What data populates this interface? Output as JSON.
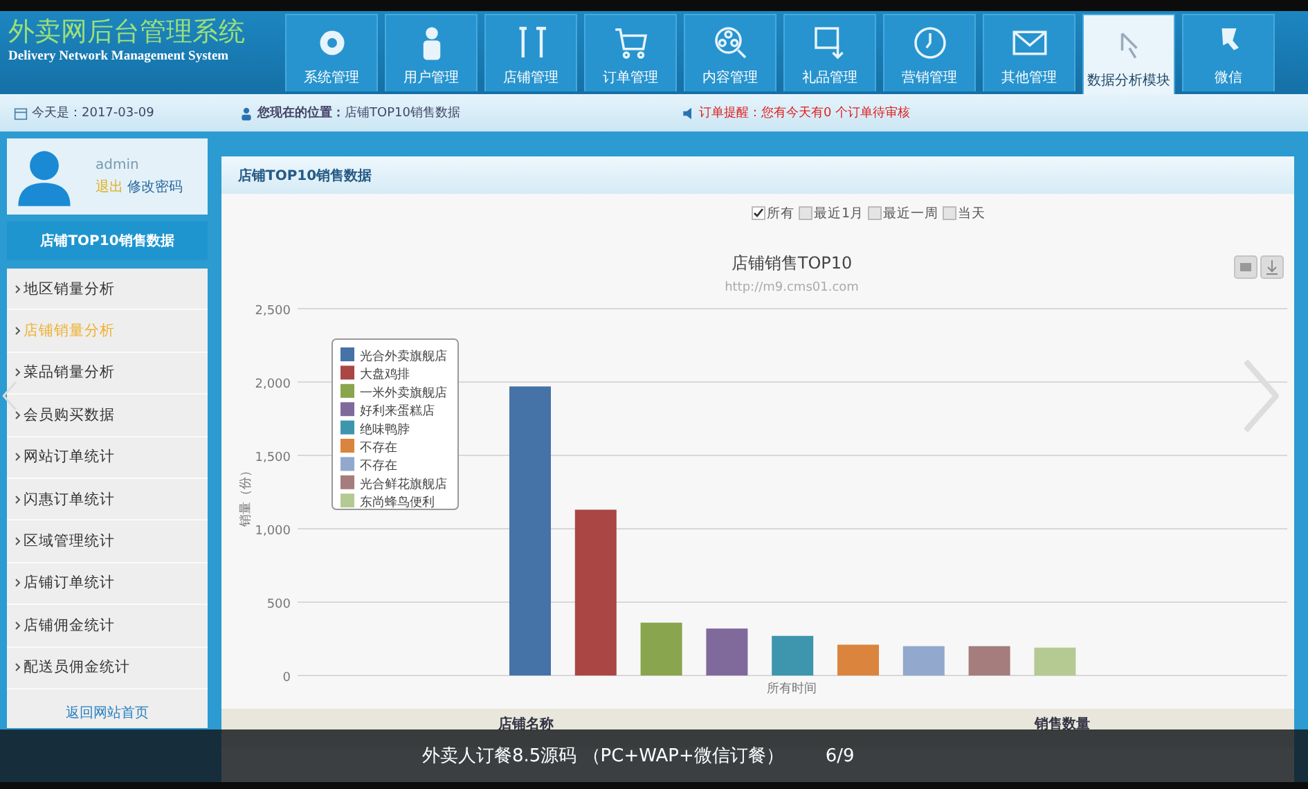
{
  "header": {
    "title": "外卖网后台管理系统",
    "subtitle": "Delivery Network Management System",
    "nav": [
      {
        "label": "系统管理",
        "selected": false
      },
      {
        "label": "用户管理",
        "selected": false
      },
      {
        "label": "店铺管理",
        "selected": false
      },
      {
        "label": "订单管理",
        "selected": false
      },
      {
        "label": "内容管理",
        "selected": false
      },
      {
        "label": "礼品管理",
        "selected": false
      },
      {
        "label": "营销管理",
        "selected": false
      },
      {
        "label": "其他管理",
        "selected": false
      },
      {
        "label": "数据分析模块",
        "selected": true
      },
      {
        "label": "微信",
        "selected": false
      }
    ]
  },
  "info_bar": {
    "date": "今天是：2017-03-09",
    "location": "**您现在的位置：**店铺TOP10销售数据",
    "alert": "订单提醒：您有今天有0 个订单待审核"
  },
  "sidebar": {
    "user": "admin",
    "logout": "退出",
    "change_password": "修改密码",
    "title": "店铺TOP10销售数据",
    "items": [
      {
        "label": "地区销量分析",
        "selected": false
      },
      {
        "label": "店铺销量分析",
        "selected": true
      },
      {
        "label": "菜品销量分析",
        "selected": false
      },
      {
        "label": "会员购买数据",
        "selected": false
      },
      {
        "label": "网站订单统计",
        "selected": false
      },
      {
        "label": "闪惠订单统计",
        "selected": false
      },
      {
        "label": "区域管理统计",
        "selected": false
      },
      {
        "label": "店铺订单统计",
        "selected": false
      },
      {
        "label": "店铺佣金统计",
        "selected": false
      },
      {
        "label": "配送员佣金统计",
        "selected": false
      }
    ],
    "back_link": "返回网站首页"
  },
  "panel": {
    "title": "店铺TOP10销售数据",
    "filters": [
      {
        "label": "所有",
        "checked": true
      },
      {
        "label": "最近1月",
        "checked": false
      },
      {
        "label": "最近一周",
        "checked": false
      },
      {
        "label": "当天",
        "checked": false
      }
    ],
    "chart_subtitle": "http://m9.cms01.com",
    "chart_data": {
      "type": "bar",
      "grid": true,
      "legend": true,
      "title": "店铺销售TOP10",
      "ylabel": "销量（份）",
      "categories": [
        "所有时间"
      ],
      "ylim": [
        0,
        2500
      ],
      "yticks": [
        {
          "value": 0,
          "label": "0"
        },
        {
          "value": 500,
          "label": "500"
        },
        {
          "value": 1000,
          "label": "1,000"
        },
        {
          "value": 1500,
          "label": "1,500"
        },
        {
          "value": 2000,
          "label": "2,000"
        },
        {
          "value": 2500,
          "label": "2,500"
        }
      ],
      "series": [
        {
          "name": "光合外卖旗舰店",
          "color": "#4572a7",
          "values": [
            1970
          ]
        },
        {
          "name": "大盘鸡排",
          "color": "#aa4643",
          "values": [
            1130
          ]
        },
        {
          "name": "一米外卖旗舰店",
          "color": "#89a54e",
          "values": [
            360
          ]
        },
        {
          "name": "好利来蛋糕店",
          "color": "#80699b",
          "values": [
            320
          ]
        },
        {
          "name": "绝味鸭脖",
          "color": "#3d96ae",
          "values": [
            270
          ]
        },
        {
          "name": "不存在",
          "color": "#db843d",
          "values": [
            210
          ]
        },
        {
          "name": "不存在",
          "color": "#92a8cd",
          "values": [
            200
          ]
        },
        {
          "name": "光合鲜花旗舰店",
          "color": "#a47d7c",
          "values": [
            200
          ]
        },
        {
          "name": "东尚蜂鸟便利",
          "color": "#b5ca92",
          "values": [
            190
          ]
        }
      ]
    },
    "table_columns": [
      "店铺名称",
      "销售数量"
    ]
  },
  "caption": {
    "text": "外卖人订餐8.5源码 （PC+WAP+微信订餐）",
    "counter": "6/9"
  }
}
